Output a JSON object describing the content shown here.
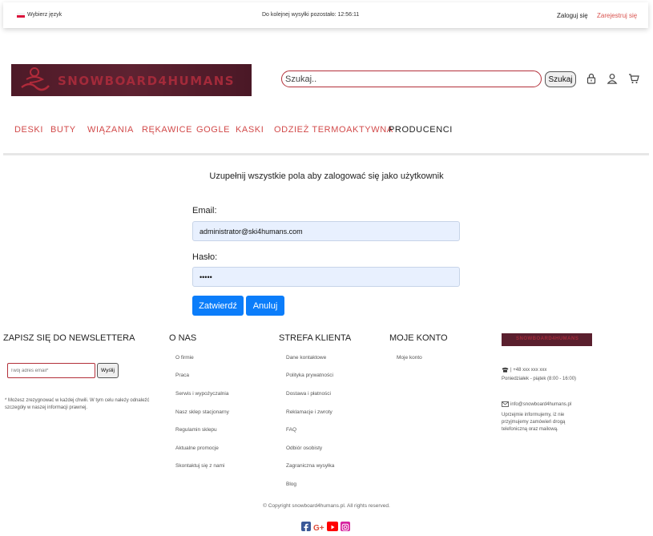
{
  "topbar": {
    "language_label": "Wybierz język",
    "countdown_text": "Do kolejnej wysyłki pozostało: 12:56:11",
    "login_label": "Zaloguj się",
    "register_label": "Zarejestruj się"
  },
  "header": {
    "logo_text": "SNOWBOARD4HUMANS",
    "search_placeholder": "Szukaj..",
    "search_button": "Szukaj"
  },
  "nav": {
    "items": [
      "DESKI",
      "BUTY",
      "WIĄZANIA",
      "RĘKAWICE",
      "GOGLE",
      "KASKI",
      "ODZIEŻ TERMOAKTYWNA",
      "PRODUCENCI"
    ]
  },
  "login_form": {
    "intro": "Uzupełnij wszystkie pola aby zalogować się jako użytkownik",
    "email_label": "Email:",
    "email_value": "administrator@ski4humans.com",
    "password_label": "Hasło:",
    "password_value": "•••••",
    "submit_label": "Zatwierdź",
    "cancel_label": "Anuluj"
  },
  "footer": {
    "newsletter": {
      "title": "ZAPISZ SIĘ DO NEWSLETTERA",
      "placeholder": "Twój adres email*",
      "button": "Wyślij",
      "note": "* Możesz zrezygnować w każdej chwili. W tym celu należy odnaleźć szczegóły w naszej informacji prawnej."
    },
    "about": {
      "title": "O NAS",
      "links": [
        "O firmie",
        "Praca",
        "Serwis i wypożyczalnia",
        "Nasz sklep stacjonarny",
        "Regulamin sklepu",
        "Aktualne promocje",
        "Skontaktuj się z nami"
      ]
    },
    "client_zone": {
      "title": "STREFA KLIENTA",
      "links": [
        "Dane kontaktowe",
        "Polityka prywatności",
        "Dostawa i płatności",
        "Reklamacje i zwroty",
        "FAQ",
        "Odbiór osobisty",
        "Zagraniczna wysyłka",
        "Blog"
      ]
    },
    "account": {
      "title": "MOJE KONTO",
      "links": [
        "Moje konto"
      ]
    },
    "contact": {
      "logo_text": "SNOWBOARD4HUMANS",
      "phone": "| +48 xxx xxx xxx",
      "hours": "Poniedziałek - piątek (8:00 - 16:00)",
      "email": "info@snowboard4humans.pl",
      "email_note": "Uprzejmie informujemy, iż nie przyjmujemy zamówień drogą telefoniczną oraz mailową."
    },
    "copyright": "© Copyright snowboard4humans.pl. All rights reserved."
  },
  "colors": {
    "accent_red": "#d24a4a",
    "brand_maroon": "#5a1f2e",
    "primary_blue": "#0b7dfa",
    "input_fill": "#e8f0fe",
    "facebook": "#3b5998",
    "google_plus": "#dd4b39",
    "youtube": "#ff0000",
    "instagram": "#d6249f"
  },
  "icons": [
    "lock-icon",
    "user-icon",
    "cart-icon",
    "phone-icon",
    "mail-icon",
    "facebook-icon",
    "google-plus-icon",
    "youtube-icon",
    "instagram-icon"
  ]
}
